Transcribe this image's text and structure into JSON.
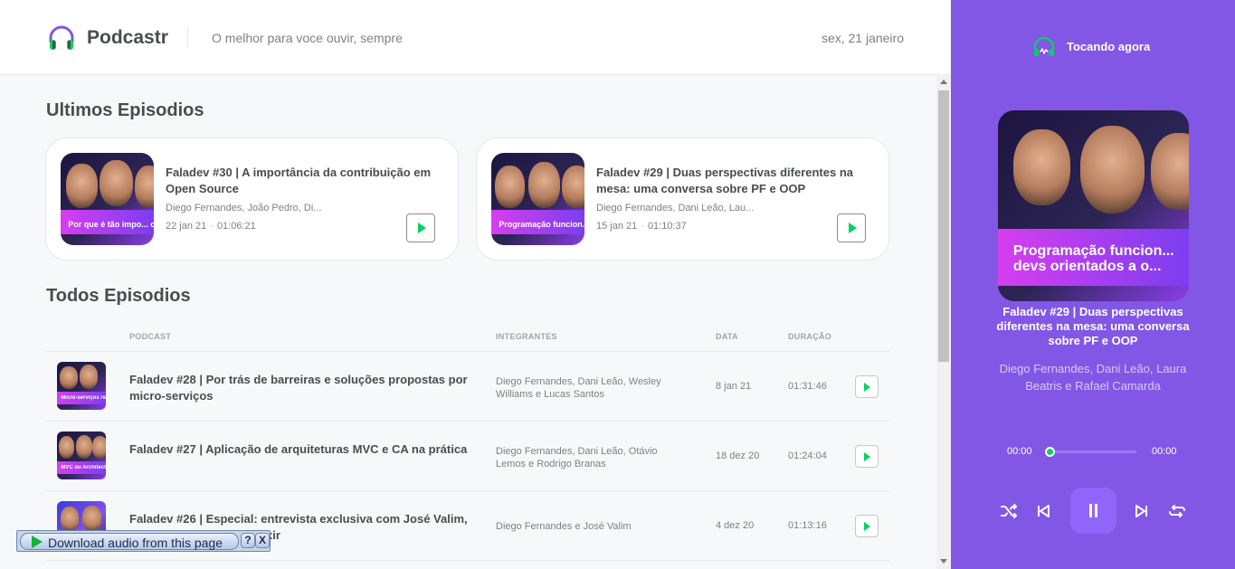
{
  "header": {
    "app_name": "Podcastr",
    "tagline": "O melhor para voce ouvir, sempre",
    "date": "sex, 21 janeiro"
  },
  "latest": {
    "title": "Ultimos Episodios",
    "episodes": [
      {
        "title": "Faladev #30 | A importância da contribuição em Open Source",
        "members": "Diego Fernandes, João Pedro, Di...",
        "date": "22 jan 21",
        "duration": "01:06:21",
        "thumb_text": "Por que é tão impo... contribuir em Open S..."
      },
      {
        "title": "Faladev #29 | Duas perspectivas diferentes na mesa: uma conversa sobre PF e OOP",
        "members": "Diego Fernandes, Dani Leão, Lau...",
        "date": "15 jan 21",
        "duration": "01:10:37",
        "thumb_text": "Programação funcion... devs orientados a o..."
      }
    ]
  },
  "all": {
    "title": "Todos Episodios",
    "columns": [
      "PODCAST",
      "INTEGRANTES",
      "DATA",
      "DURAÇÃO"
    ],
    "rows": [
      {
        "title": "Faladev #28 | Por trás de barreiras e soluções propostas por micro-serviços",
        "members": "Diego Fernandes, Dani Leão, Wesley Williams e Lucas Santos",
        "date": "8 jan 21",
        "duration": "01:31:46",
        "thumb_text": "Micro-serviços re..."
      },
      {
        "title": "Faladev #27 | Aplicação de arquiteturas MVC e CA na prática",
        "members": "Diego Fernandes, Dani Leão, Otávio Lemos e Rodrigo Branas",
        "date": "18 dez 20",
        "duration": "01:24:04",
        "thumb_text": "MVC ou Architecture..."
      },
      {
        "title": "Faladev #26 | Especial: entrevista exclusiva com José Valim, criador da linguagem Elixir",
        "members": "Diego Fernandes e José Valim",
        "date": "4 dez 20",
        "duration": "01:13:16",
        "thumb_text": ""
      }
    ]
  },
  "download_bar": {
    "label": "Download audio from this page",
    "help": "?",
    "close": "X"
  },
  "player": {
    "label": "Tocando agora",
    "title": "Faladev #29 | Duas perspectivas diferentes na mesa: uma conversa sobre PF e OOP",
    "members": "Diego Fernandes, Dani Leão, Laura Beatris e Rafael Camarda",
    "thumb_text": "Programação funcion... devs orientados a o...",
    "current_time": "00:00",
    "total_time": "00:00",
    "progress": 0
  },
  "colors": {
    "brand_purple": "#8257e5",
    "accent_green": "#04d361"
  }
}
